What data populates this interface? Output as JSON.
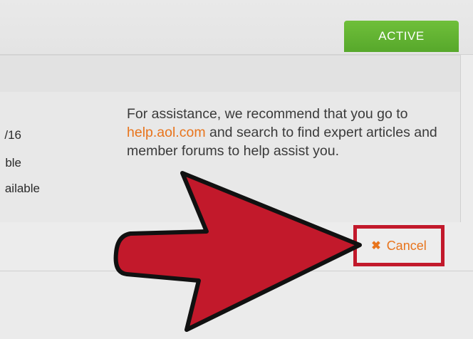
{
  "status": {
    "label": "ACTIVE"
  },
  "account_details": {
    "lines": [
      "/16",
      "ble",
      "ailable"
    ]
  },
  "help": {
    "text_before": "For assistance, we recommend that you go to ",
    "link_text": "help.aol.com",
    "text_after": " and search to find expert articles and member forums to help assist you."
  },
  "cancel": {
    "label": "Cancel",
    "icon": "close-icon"
  },
  "annotation": {
    "arrow_color": "#c2192b",
    "highlight_color": "#c2192b"
  },
  "colors": {
    "accent_orange": "#e8741c",
    "active_green": "#5fb031"
  }
}
